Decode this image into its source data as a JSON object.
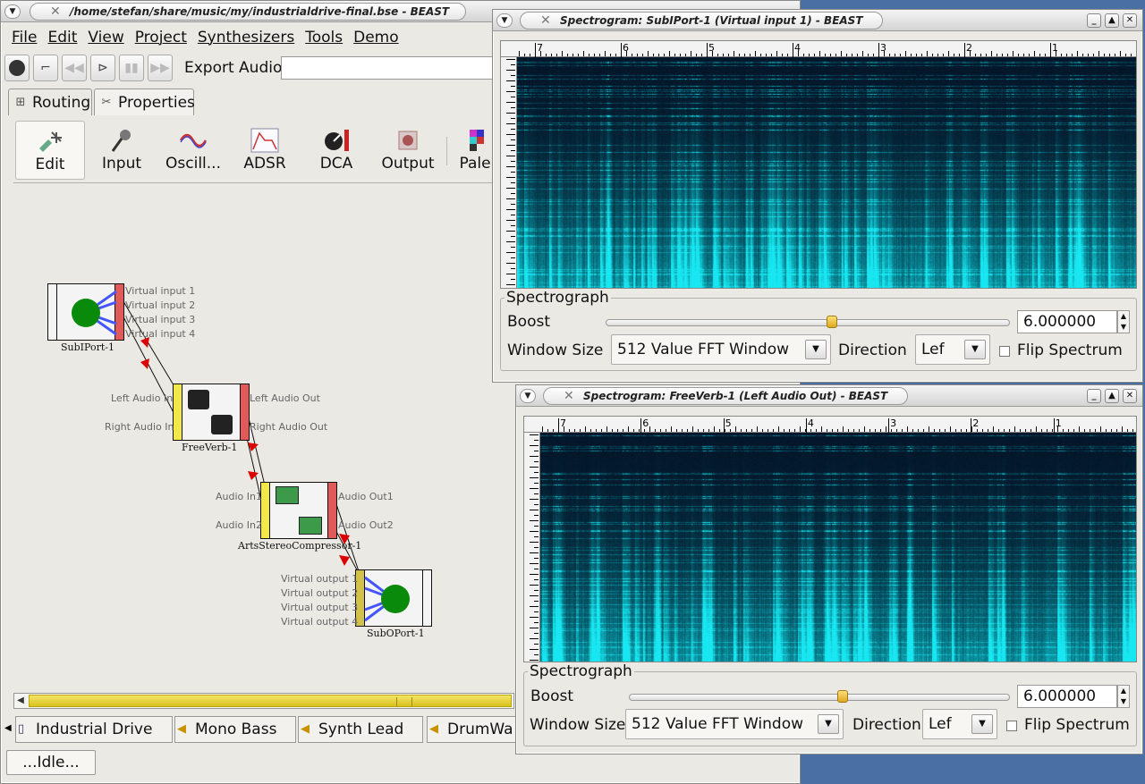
{
  "main_window": {
    "title": "/home/stefan/share/music/my/industrialdrive-final.bse - BEAST",
    "menu": [
      "File",
      "Edit",
      "View",
      "Project",
      "Synthesizers",
      "Tools",
      "Demo"
    ],
    "export_label": "Export Audio",
    "export_value": "",
    "tabs": [
      "Routing",
      "Properties"
    ],
    "palette": [
      "Edit",
      "Input",
      "Oscill...",
      "ADSR",
      "DCA",
      "Output",
      "Pale"
    ],
    "modules": {
      "subiport": {
        "name": "SubIPort-1",
        "ports": [
          "Virtual input 1",
          "Virtual input 2",
          "Virtual input 3",
          "Virtual input 4"
        ]
      },
      "freeverb": {
        "name": "FreeVerb-1",
        "in_ports": [
          "Left Audio In",
          "Right Audio In"
        ],
        "out_ports": [
          "Left Audio Out",
          "Right Audio Out"
        ]
      },
      "compressor": {
        "name": "ArtsStereoCompressor-1",
        "in_ports": [
          "Audio In1",
          "Audio In2"
        ],
        "out_ports": [
          "Audio Out1",
          "Audio Out2"
        ]
      },
      "suboport": {
        "name": "SubOPort-1",
        "ports": [
          "Virtual output 1",
          "Virtual output 2",
          "Virtual output 3",
          "Virtual output 4"
        ]
      }
    },
    "tracks": [
      "Industrial Drive",
      "Mono Bass",
      "Synth Lead",
      "DrumWa"
    ],
    "status": "...Idle..."
  },
  "spectrogram_1": {
    "title": "Spectrogram: SubIPort-1 (Virtual input 1) - BEAST",
    "ruler_ticks": [
      "7",
      "6",
      "5",
      "4",
      "3",
      "2",
      "1"
    ],
    "group_title": "Spectrograph",
    "boost_label": "Boost",
    "boost_value": "6.000000",
    "boost_level": 0.56,
    "window_size_label": "Window Size",
    "window_size_value": "512 Value FFT Window",
    "direction_label": "Direction",
    "direction_value": "Lef",
    "flip_label": "Flip Spectrum"
  },
  "spectrogram_2": {
    "title": "Spectrogram: FreeVerb-1 (Left Audio Out) - BEAST",
    "ruler_ticks": [
      "7",
      "6",
      "5",
      "4",
      "3",
      "2",
      "1"
    ],
    "group_title": "Spectrograph",
    "boost_label": "Boost",
    "boost_value": "6.000000",
    "boost_level": 0.56,
    "window_size_label": "Window Size",
    "window_size_value": "512 Value FFT Window",
    "direction_label": "Direction",
    "direction_value": "Lef",
    "flip_label": "Flip Spectrum"
  },
  "colors": {
    "desktop": "#4a6fa5",
    "spectrum_low": "#031328",
    "spectrum_high": "#14e6f0",
    "accent": "#f0d830"
  }
}
